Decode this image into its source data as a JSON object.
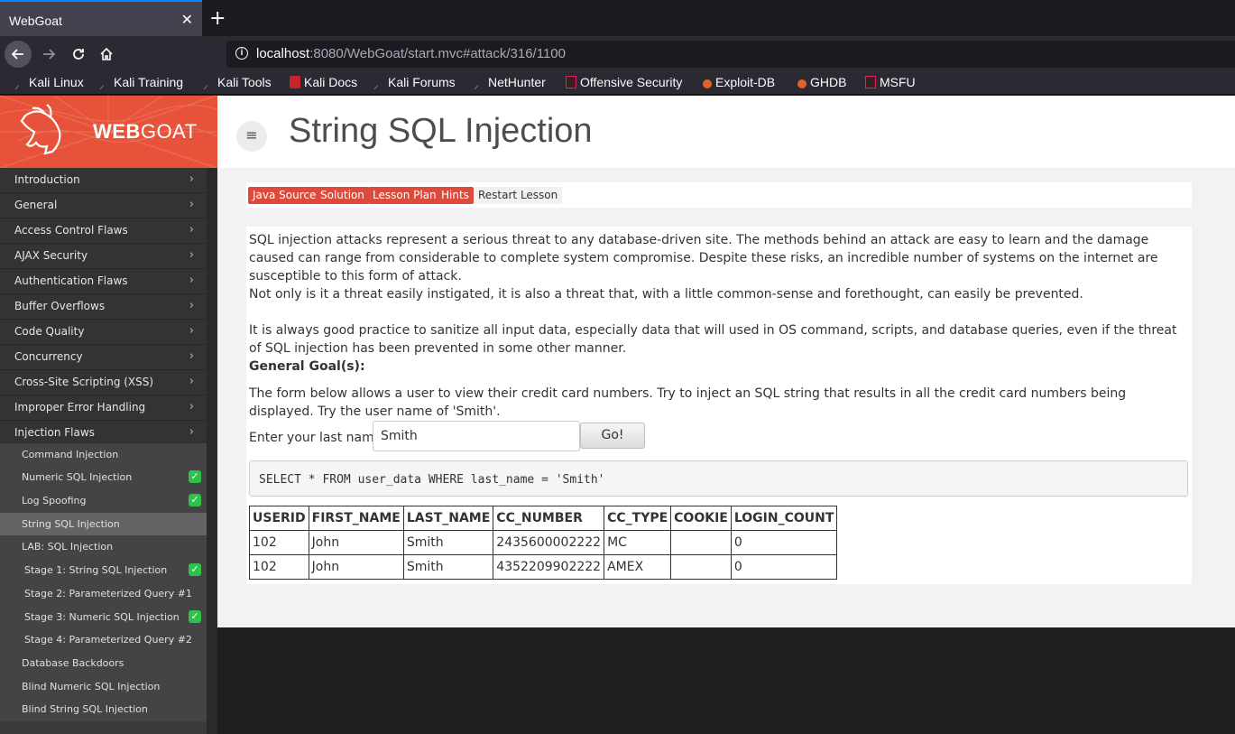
{
  "browser": {
    "tab_title": "WebGoat",
    "tab_close": "✕",
    "new_tab": "+",
    "url_host": "localhost",
    "url_rest": ":8080/WebGoat/start.mvc#attack/316/1100",
    "bookmarks": [
      "Kali Linux",
      "Kali Training",
      "Kali Tools",
      "Kali Docs",
      "Kali Forums",
      "NetHunter",
      "Offensive Security",
      "Exploit-DB",
      "GHDB",
      "MSFU"
    ]
  },
  "logo": {
    "brand_a": "WEB",
    "brand_b": "GOAT"
  },
  "menu": {
    "categories": [
      "Introduction",
      "General",
      "Access Control Flaws",
      "AJAX Security",
      "Authentication Flaws",
      "Buffer Overflows",
      "Code Quality",
      "Concurrency",
      "Cross-Site Scripting (XSS)",
      "Improper Error Handling",
      "Injection Flaws"
    ],
    "subitems": [
      {
        "label": "Command Injection",
        "done": false
      },
      {
        "label": "Numeric SQL Injection",
        "done": true
      },
      {
        "label": "Log Spoofing",
        "done": true
      },
      {
        "label": "String SQL Injection",
        "done": false
      },
      {
        "label": "LAB: SQL Injection",
        "done": false
      },
      {
        "label": "Stage 1: String SQL Injection",
        "done": true
      },
      {
        "label": "Stage 2: Parameterized Query #1",
        "done": false
      },
      {
        "label": "Stage 3: Numeric SQL Injection",
        "done": true
      },
      {
        "label": "Stage 4: Parameterized Query #2",
        "done": false
      },
      {
        "label": "Database Backdoors",
        "done": false
      },
      {
        "label": "Blind Numeric SQL Injection",
        "done": false
      },
      {
        "label": "Blind String SQL Injection",
        "done": false
      }
    ]
  },
  "header": {
    "title": "String SQL Injection",
    "menu_icon": "≡"
  },
  "lesson_buttons": [
    "Java Source",
    "Solution",
    "Lesson Plan",
    "Hints",
    "Restart Lesson"
  ],
  "content": {
    "para1": "SQL injection attacks represent a serious threat to any database-driven site. The methods behind an attack are easy to learn and the damage caused can range from considerable to complete system compromise. Despite these risks, an incredible number of systems on the internet are susceptible to this form of attack.",
    "para2": "Not only is it a threat easily instigated, it is also a threat that, with a little common-sense and forethought, can easily be prevented.",
    "para3": "It is always good practice to sanitize all input data, especially data that will used in OS command, scripts, and database queries, even if the threat of SQL injection has been prevented in some other manner.",
    "goal_heading": "General Goal(s):",
    "goal_text": "The form below allows a user to view their credit card numbers. Try to inject an SQL string that results in all the credit card numbers being displayed. Try the user name of 'Smith'.",
    "form_label": "Enter your last name:",
    "last_name_value": "Smith",
    "go_label": "Go!",
    "sql_query": "SELECT * FROM user_data WHERE last_name = 'Smith'"
  },
  "results": {
    "headers": [
      "USERID",
      "FIRST_NAME",
      "LAST_NAME",
      "CC_NUMBER",
      "CC_TYPE",
      "COOKIE",
      "LOGIN_COUNT"
    ],
    "rows": [
      [
        "102",
        "John",
        "Smith",
        "2435600002222",
        "MC",
        "",
        "0"
      ],
      [
        "102",
        "John",
        "Smith",
        "4352209902222",
        "AMEX",
        "",
        "0"
      ]
    ]
  }
}
